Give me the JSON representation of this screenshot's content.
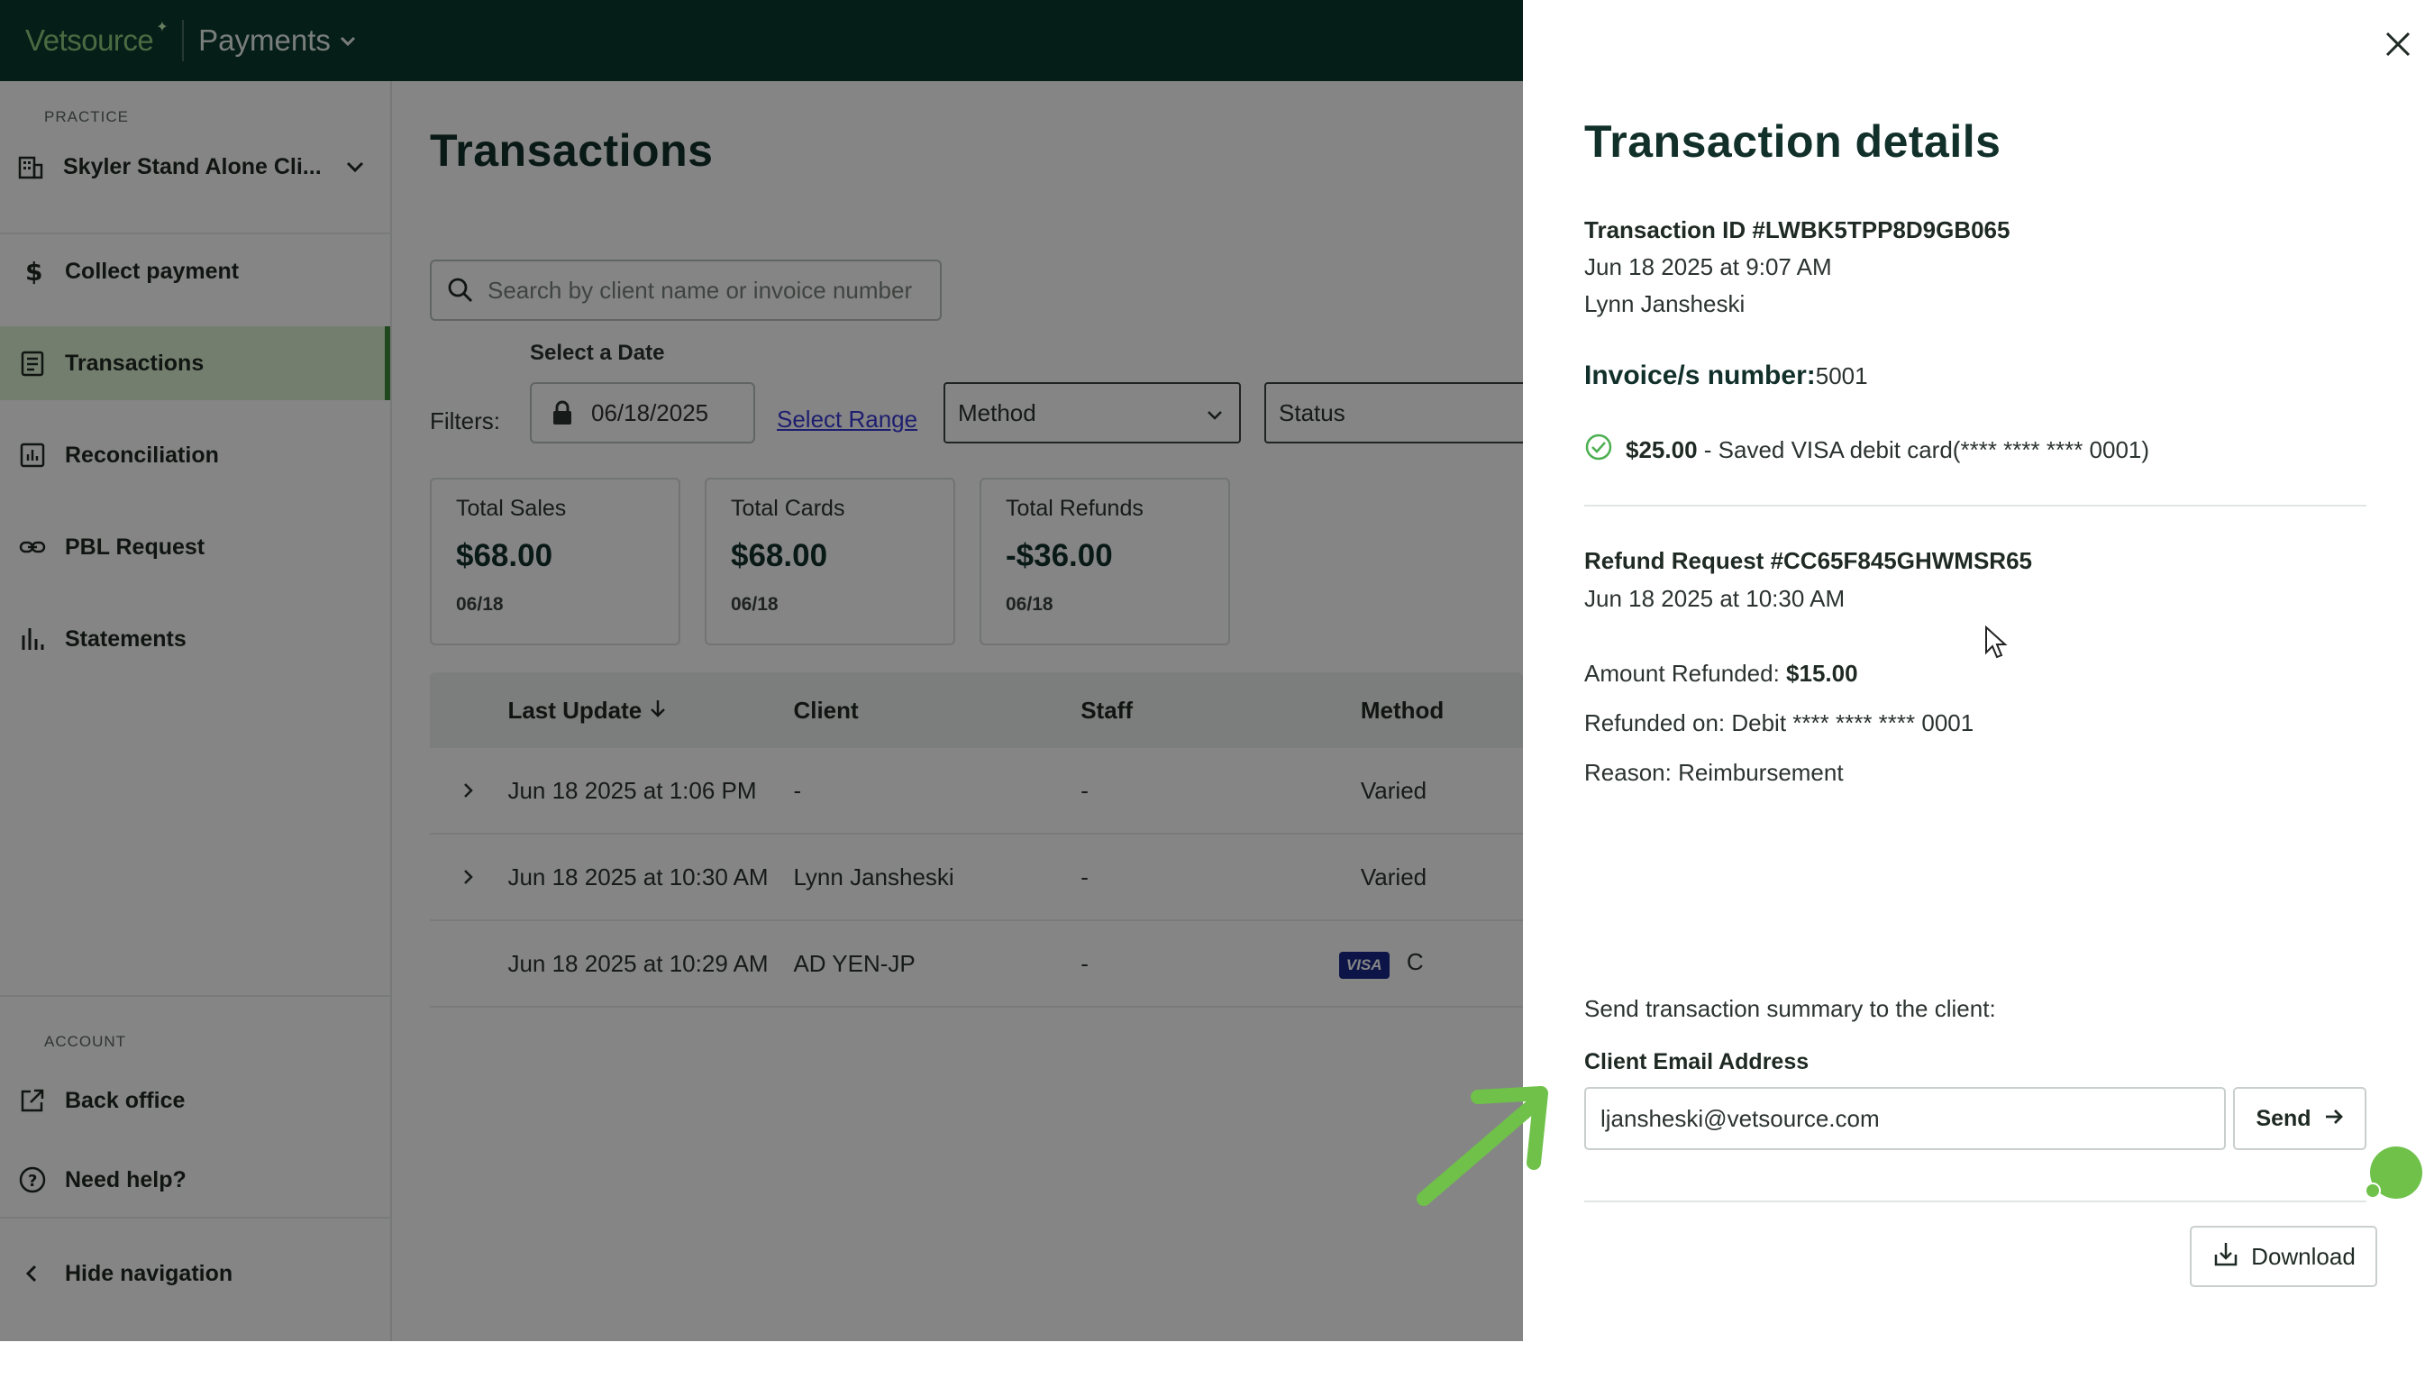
{
  "app": {
    "brand": "Vetsource",
    "product": "Payments"
  },
  "sidebar": {
    "practice_label": "PRACTICE",
    "practice_name": "Skyler Stand Alone Cli...",
    "items": [
      {
        "label": "Collect payment",
        "icon": "dollar-icon"
      },
      {
        "label": "Transactions",
        "icon": "receipt-icon",
        "active": true
      },
      {
        "label": "Reconciliation",
        "icon": "chart-icon"
      },
      {
        "label": "PBL Request",
        "icon": "link-icon"
      },
      {
        "label": "Statements",
        "icon": "bar-chart-icon"
      }
    ],
    "account_label": "ACCOUNT",
    "account_items": [
      {
        "label": "Back office",
        "icon": "external-link-icon"
      },
      {
        "label": "Need help?",
        "icon": "help-icon"
      }
    ],
    "hide_nav": "Hide navigation"
  },
  "main": {
    "title": "Transactions",
    "search_placeholder": "Search by client name or invoice number",
    "date_label": "Select a Date",
    "filters_label": "Filters:",
    "date_value": "06/18/2025",
    "select_range": "Select Range",
    "method_dropdown": "Method",
    "status_dropdown": "Status",
    "stats": [
      {
        "label": "Total Sales",
        "value": "$68.00",
        "date": "06/18"
      },
      {
        "label": "Total Cards",
        "value": "$68.00",
        "date": "06/18"
      },
      {
        "label": "Total Refunds",
        "value": "-$36.00",
        "date": "06/18"
      }
    ],
    "table": {
      "columns": [
        "Last Update",
        "Client",
        "Staff",
        "Method"
      ],
      "rows": [
        {
          "last_update": "Jun 18 2025 at 1:06 PM",
          "client": "-",
          "staff": "-",
          "method": "Varied",
          "expandable": true
        },
        {
          "last_update": "Jun 18 2025 at 10:30 AM",
          "client": "Lynn Jansheski",
          "staff": "-",
          "method": "Varied",
          "expandable": true
        },
        {
          "last_update": "Jun 18 2025 at 10:29 AM",
          "client": "AD YEN-JP",
          "staff": "-",
          "method": "C",
          "card_brand": "VISA",
          "expandable": false
        }
      ]
    }
  },
  "drawer": {
    "title": "Transaction details",
    "transaction_id": "Transaction ID #LWBK5TPP8D9GB065",
    "transaction_date": "Jun 18 2025 at 9:07 AM",
    "transaction_client": "Lynn Jansheski",
    "invoice_key": "Invoice/s number:",
    "invoice_value": "5001",
    "payment_amount": "$25.00",
    "payment_desc": " - Saved VISA debit card(**** **** **** 0001)",
    "refund_id": "Refund Request #CC65F845GHWMSR65",
    "refund_date": "Jun 18 2025 at 10:30 AM",
    "amount_refunded_key": "Amount Refunded: ",
    "amount_refunded_value": "$15.00",
    "refunded_on": "Refunded on: Debit **** **** **** 0001",
    "reason": "Reason: Reimbursement",
    "send_summary": "Send transaction summary to the client:",
    "email_label": "Client Email Address",
    "email_value": "ljansheski@vetsource.com",
    "send_label": "Send",
    "download_label": "Download"
  },
  "colors": {
    "topbar": "#0d3b2e",
    "brand_green": "#8fce7f",
    "active_nav": "#dff2d4",
    "annotation_green": "#6fc14a"
  }
}
